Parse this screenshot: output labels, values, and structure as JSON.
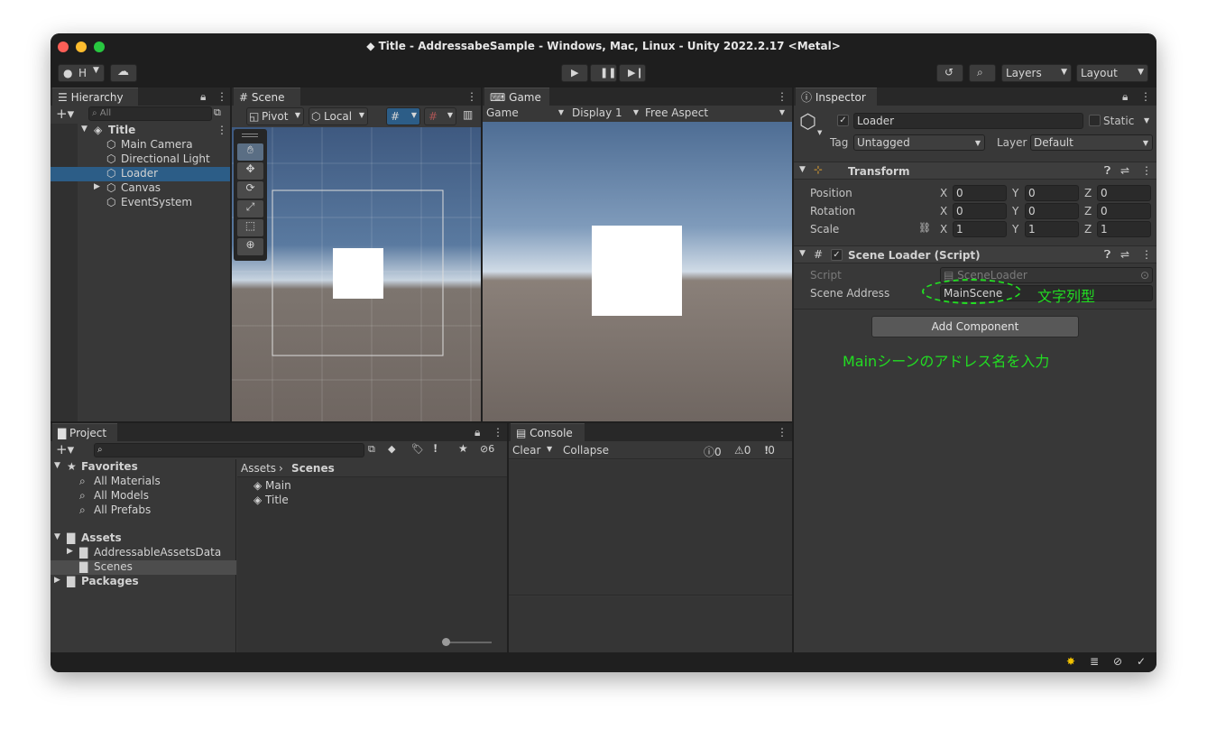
{
  "window": {
    "title": "Title - AddressabeSample - Windows, Mac, Linux - Unity 2022.2.17 <Metal>"
  },
  "toolbar": {
    "account": "H",
    "layers": "Layers",
    "layout": "Layout"
  },
  "hierarchy": {
    "tab": "Hierarchy",
    "search_placeholder": "All",
    "scene": "Title",
    "items": [
      "Main Camera",
      "Directional Light",
      "Loader",
      "Canvas",
      "EventSystem"
    ]
  },
  "scene_view": {
    "tab": "Scene",
    "pivot": "Pivot",
    "local": "Local"
  },
  "game_view": {
    "tab": "Game",
    "mode": "Game",
    "display": "Display 1",
    "aspect": "Free Aspect"
  },
  "inspector": {
    "tab": "Inspector",
    "object_name": "Loader",
    "static_label": "Static",
    "tag_label": "Tag",
    "tag_value": "Untagged",
    "layer_label": "Layer",
    "layer_value": "Default",
    "transform": {
      "title": "Transform",
      "rows": [
        {
          "label": "Position",
          "x": "0",
          "y": "0",
          "z": "0"
        },
        {
          "label": "Rotation",
          "x": "0",
          "y": "0",
          "z": "0"
        },
        {
          "label": "Scale",
          "x": "1",
          "y": "1",
          "z": "1"
        }
      ],
      "x_label": "X",
      "y_label": "Y",
      "z_label": "Z"
    },
    "script_component": {
      "title": "Scene Loader (Script)",
      "script_label": "Script",
      "script_value": "SceneLoader",
      "address_label": "Scene Address",
      "address_value": "MainScene"
    },
    "add_component": "Add Component"
  },
  "annotations": {
    "type_note": "文字列型",
    "input_note": "Mainシーンのアドレス名を入力"
  },
  "project": {
    "tab": "Project",
    "favorites": "Favorites",
    "fav_items": [
      "All Materials",
      "All Models",
      "All Prefabs"
    ],
    "assets": "Assets",
    "asset_folders": [
      "AddressableAssetsData",
      "Scenes"
    ],
    "packages": "Packages",
    "breadcrumb_root": "Assets",
    "breadcrumb_current": "Scenes",
    "files": [
      "Main",
      "Title"
    ],
    "hidden_count": "6"
  },
  "console": {
    "tab": "Console",
    "clear": "Clear",
    "collapse": "Collapse",
    "info_count": "0",
    "warn_count": "0",
    "error_count": "0"
  },
  "colors": {
    "selection": "#2c5d87",
    "annotation": "#22dd22",
    "panel": "#383838"
  }
}
